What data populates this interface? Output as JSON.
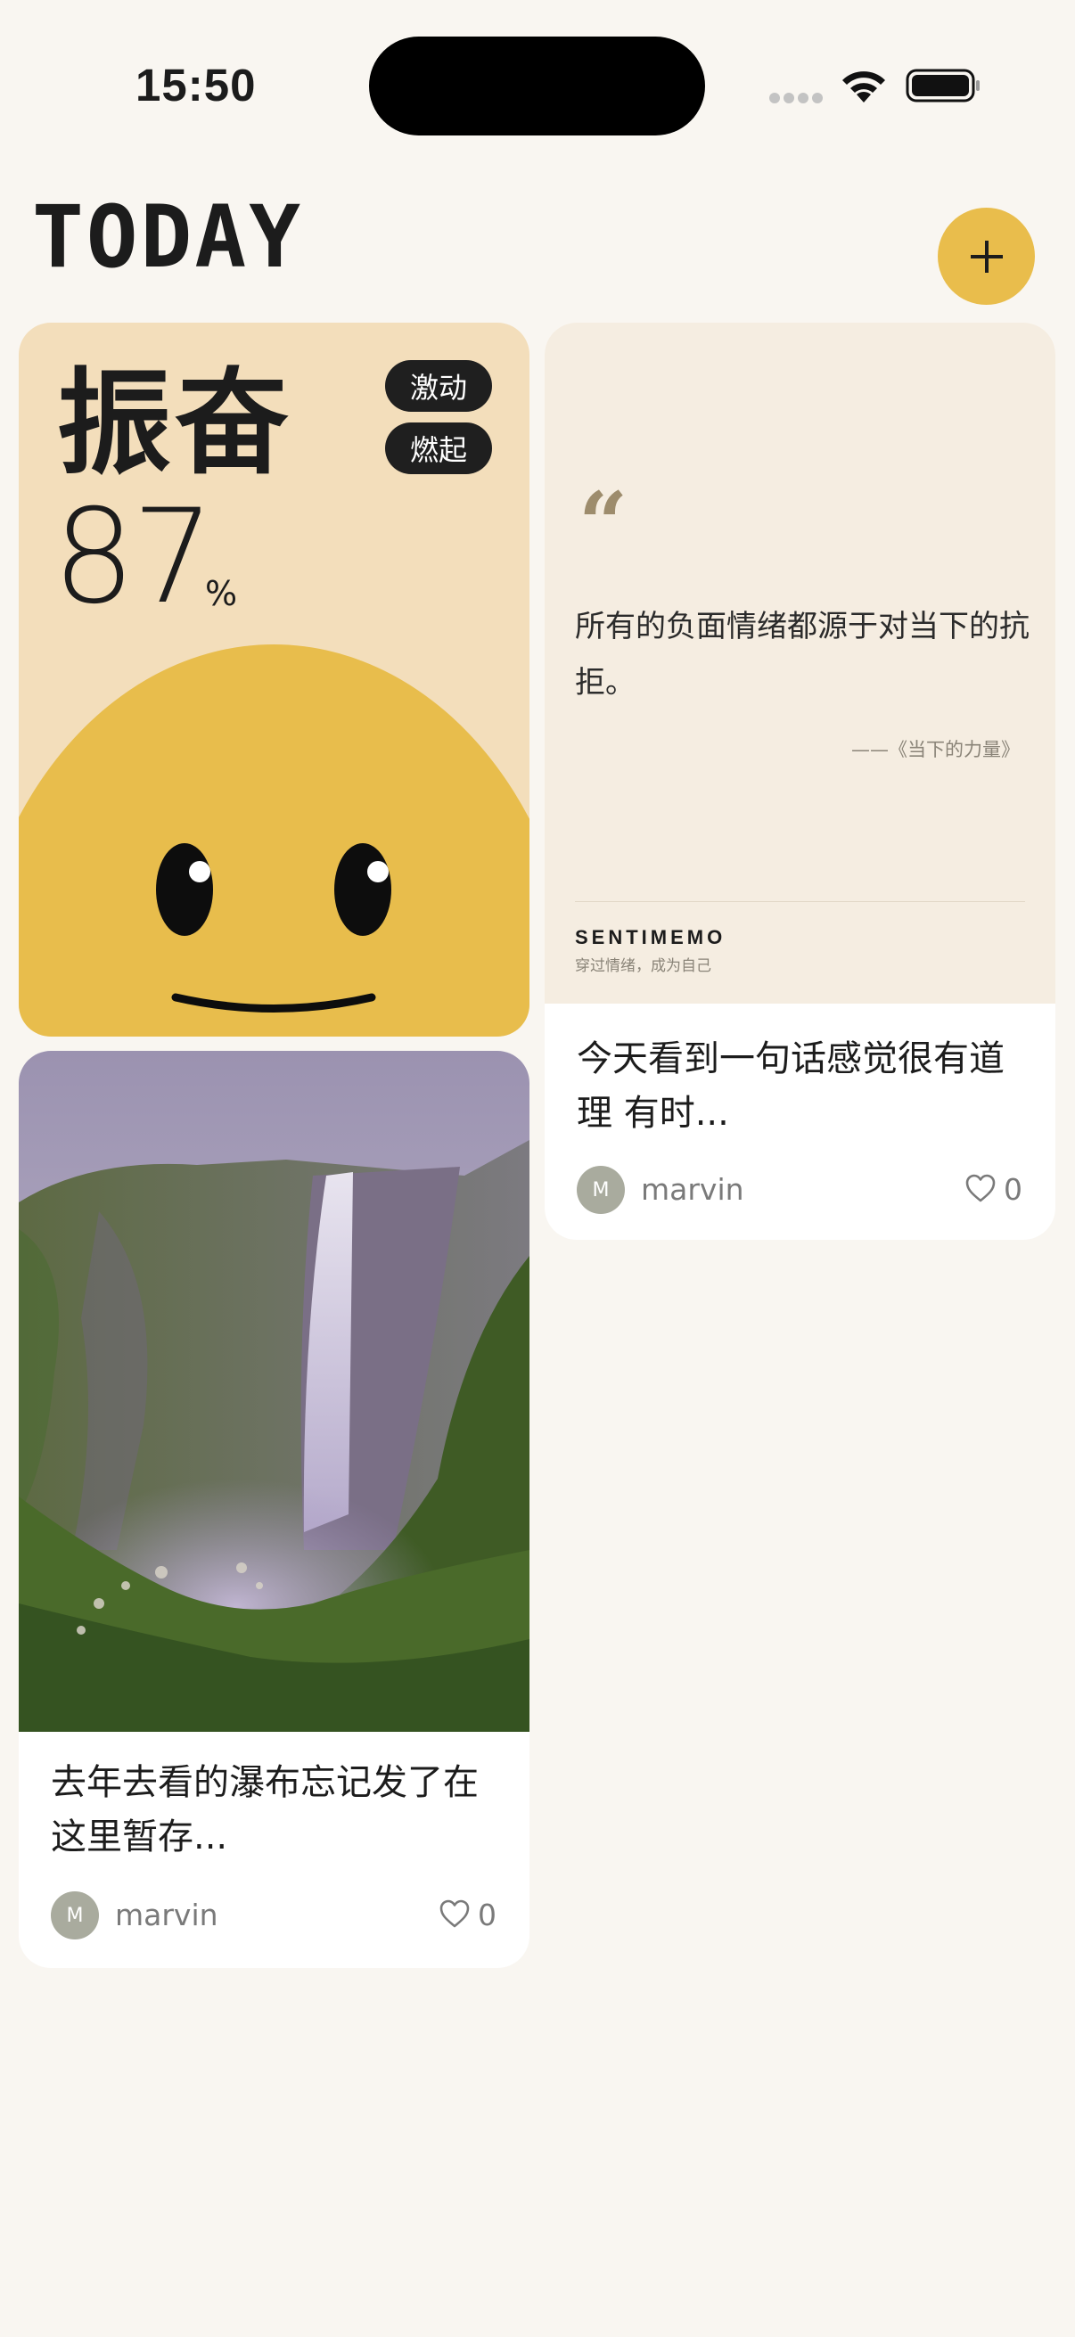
{
  "status_bar": {
    "time": "15:50",
    "icons": [
      "signal-icon",
      "wifi-icon",
      "battery-icon"
    ]
  },
  "header": {
    "title": "TODAY",
    "add_icon": "plus-icon"
  },
  "colors": {
    "background": "#f9f6f1",
    "accent": "#e9bd4c",
    "mood_card": "#f3debb",
    "quote_card": "#f5ede1"
  },
  "mood_card": {
    "mood": "振奋",
    "score": "87",
    "unit": "%",
    "tags": [
      "激动",
      "燃起"
    ]
  },
  "quote_card": {
    "quote": "所有的负面情绪都源于对当下的抗拒。",
    "source": "——《当下的力量》",
    "brand": "SENTIMEMO",
    "slogan": "穿过情绪，成为自己",
    "post_title": "今天看到一句话感觉很有道理 有时...",
    "author_initial": "M",
    "author": "marvin",
    "likes": "0"
  },
  "photo_card": {
    "post_title": "去年去看的瀑布忘记发了在这里暂存...",
    "author_initial": "M",
    "author": "marvin",
    "likes": "0"
  }
}
